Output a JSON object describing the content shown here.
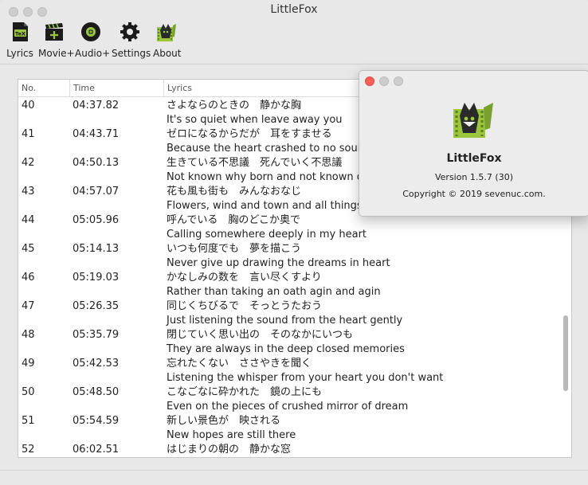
{
  "window": {
    "title": "LittleFox"
  },
  "toolbar": {
    "items": [
      {
        "label": "Lyrics",
        "icon": "lyrics-file-icon"
      },
      {
        "label": "Movie+",
        "icon": "clapperboard-icon"
      },
      {
        "label": "Audio+",
        "icon": "cd-disc-icon"
      },
      {
        "label": "Settings",
        "icon": "gear-icon"
      },
      {
        "label": "About",
        "icon": "fox-app-icon"
      }
    ]
  },
  "table": {
    "headers": {
      "no": "No.",
      "time": "Time",
      "lyrics": "Lyrics"
    },
    "rows": [
      {
        "no": "40",
        "time": "04:37.82",
        "jp": "さよならのときの　静かな胸",
        "en": "It's so quiet when leave away you"
      },
      {
        "no": "41",
        "time": "04:43.71",
        "jp": "ゼロになるからだが　耳をすませる",
        "en": "Because the heart crashed to no sound"
      },
      {
        "no": "42",
        "time": "04:50.13",
        "jp": "生きている不思議　死んでいく不思議",
        "en": "Not known why born and not known dyin"
      },
      {
        "no": "43",
        "time": "04:57.07",
        "jp": "花も風も街も　みんなおなじ",
        "en": "Flowers, wind and town and all things of"
      },
      {
        "no": "44",
        "time": "05:05.96",
        "jp": "呼んでいる　胸のどこか奥で",
        "en": "Calling somewhere deeply in my heart"
      },
      {
        "no": "45",
        "time": "05:14.13",
        "jp": "いつも何度でも　夢を描こう",
        "en": "Never give up drawing the dreams in heart"
      },
      {
        "no": "46",
        "time": "05:19.03",
        "jp": "かなしみの数を　言い尽くすより",
        "en": "Rather than taking an oath agin and agin"
      },
      {
        "no": "47",
        "time": "05:26.35",
        "jp": "同じくちびるで　そっとうたおう",
        "en": "Just listening the sound from the heart gently"
      },
      {
        "no": "48",
        "time": "05:35.79",
        "jp": "閉じていく思い出の　そのなかにいつも",
        "en": "They are always in the deep closed memories"
      },
      {
        "no": "49",
        "time": "05:42.53",
        "jp": "忘れたくない　ささやきを聞く",
        "en": "Listening the whisper from your heart you don't want"
      },
      {
        "no": "50",
        "time": "05:48.50",
        "jp": "こなごなに砕かれた　鏡の上にも",
        "en": "Even on the pieces of crushed mirror of dream"
      },
      {
        "no": "51",
        "time": "05:54.59",
        "jp": "新しい景色が　映される",
        "en": "New hopes are still there"
      },
      {
        "no": "52",
        "time": "06:02.51",
        "jp": "はじまりの朝の　静かな窓",
        "en": ""
      }
    ]
  },
  "about": {
    "name": "LittleFox",
    "version": "Version 1.5.7 (30)",
    "copyright": "Copyright © 2019 sevenuc.com."
  }
}
